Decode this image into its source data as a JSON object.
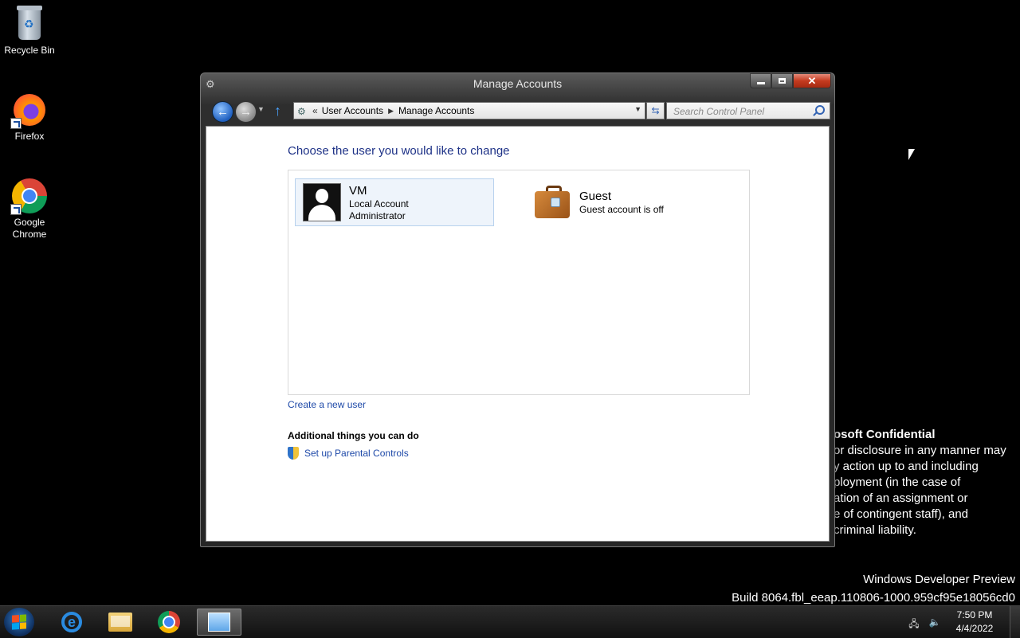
{
  "desktop": {
    "icons": [
      {
        "label": "Recycle Bin",
        "icon": "recycle-bin-icon"
      },
      {
        "label": "Firefox",
        "icon": "firefox-icon"
      },
      {
        "label": "Google\nChrome",
        "icon": "chrome-icon"
      }
    ],
    "watermark": {
      "heading": "osoft Confidential",
      "lines": [
        "or disclosure in any manner may",
        "y action up to and including",
        "ployment (in the case of",
        "ation of an assignment or",
        "e of contingent staff), and",
        "criminal liability."
      ]
    },
    "build": {
      "line1": "Windows Developer Preview",
      "line2": "Build 8064.fbl_eeap.110806-1000.959cf95e18056cd0"
    }
  },
  "window": {
    "title": "Manage Accounts",
    "breadcrumb": {
      "prefix": "«",
      "items": [
        "User Accounts",
        "Manage Accounts"
      ]
    },
    "search": {
      "placeholder": "Search Control Panel",
      "value": ""
    },
    "heading": "Choose the user you would like to change",
    "accounts": [
      {
        "name": "VM",
        "lines": [
          "Local Account",
          "Administrator"
        ],
        "selected": true
      },
      {
        "name": "Guest",
        "lines": [
          "Guest account is off"
        ],
        "selected": false
      }
    ],
    "create_link": "Create a new user",
    "additional_heading": "Additional things you can do",
    "parental_link": "Set up Parental Controls"
  },
  "taskbar": {
    "pinned": [
      "internet-explorer-icon",
      "file-explorer-icon",
      "chrome-icon",
      "control-panel-icon"
    ],
    "clock": {
      "time": "7:50 PM",
      "date": "4/4/2022"
    }
  },
  "colors": {
    "link": "#1e49a8",
    "heading": "#1e3287",
    "selection_bg": "#eef4fb",
    "close_button": "#c43b1f"
  }
}
